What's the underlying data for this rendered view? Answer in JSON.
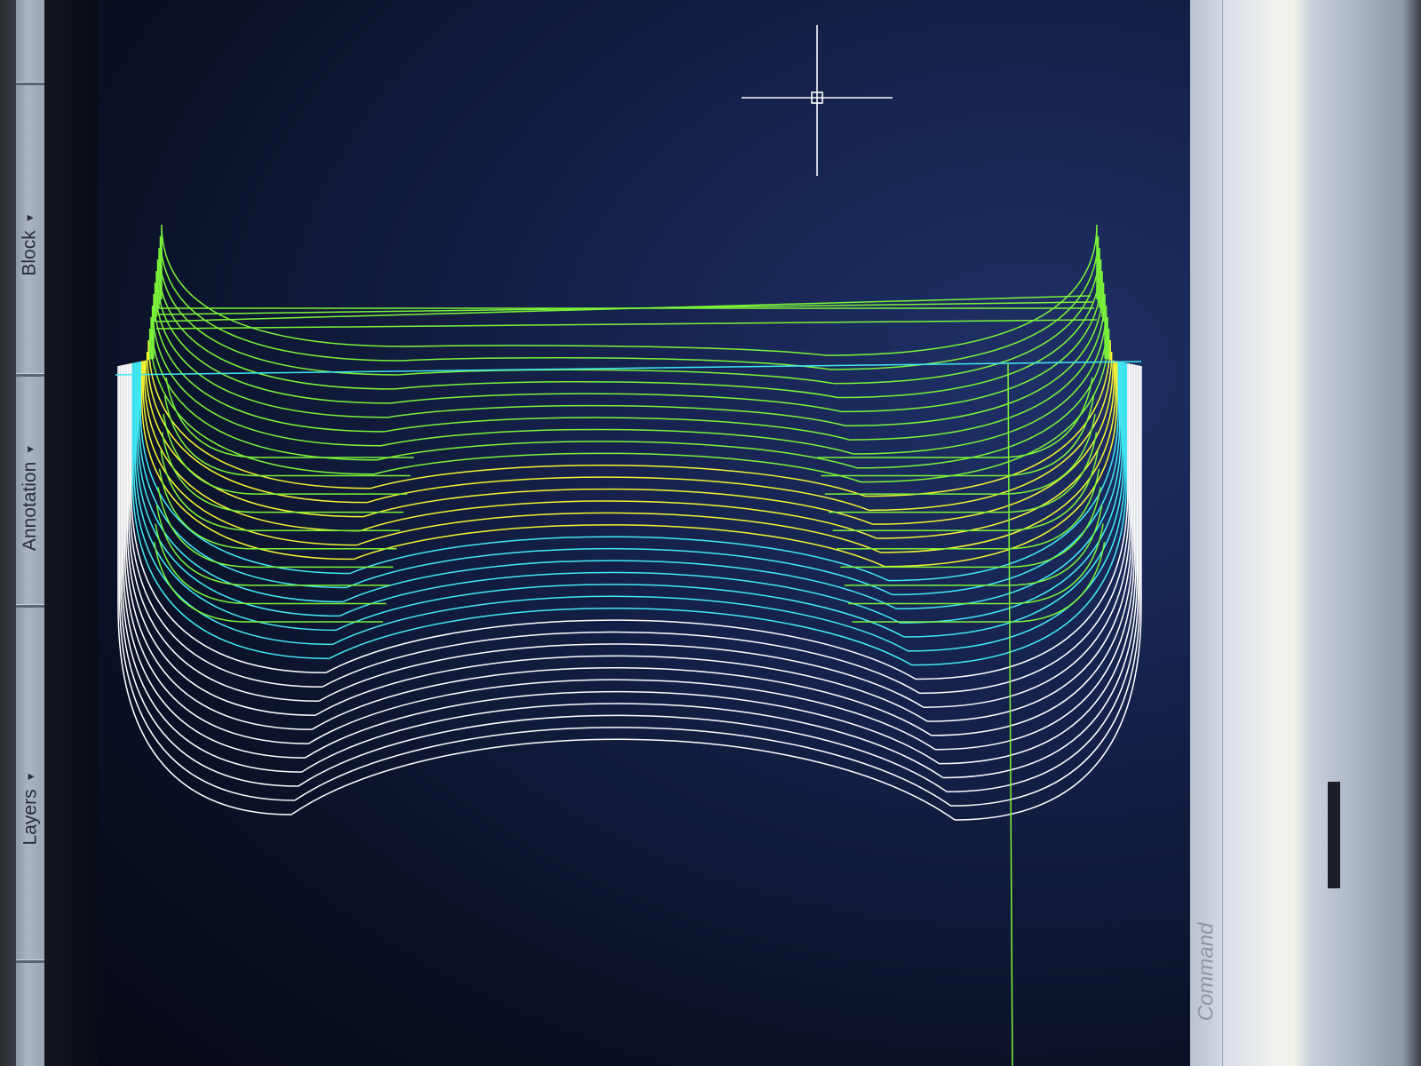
{
  "ribbon": {
    "panels": [
      {
        "id": "block",
        "label": "Block",
        "caret": "▼"
      },
      {
        "id": "annotation",
        "label": "Annotation",
        "caret": "▼"
      },
      {
        "id": "layers",
        "label": "Layers",
        "caret": "▼"
      }
    ]
  },
  "command_line": {
    "label": "Command"
  },
  "colors": {
    "background": "#15214a",
    "white_lines": "#ffffff",
    "cyan_lines": "#41e8f4",
    "yellow_lines": "#f4f434",
    "green_lines": "#7cf43a"
  }
}
